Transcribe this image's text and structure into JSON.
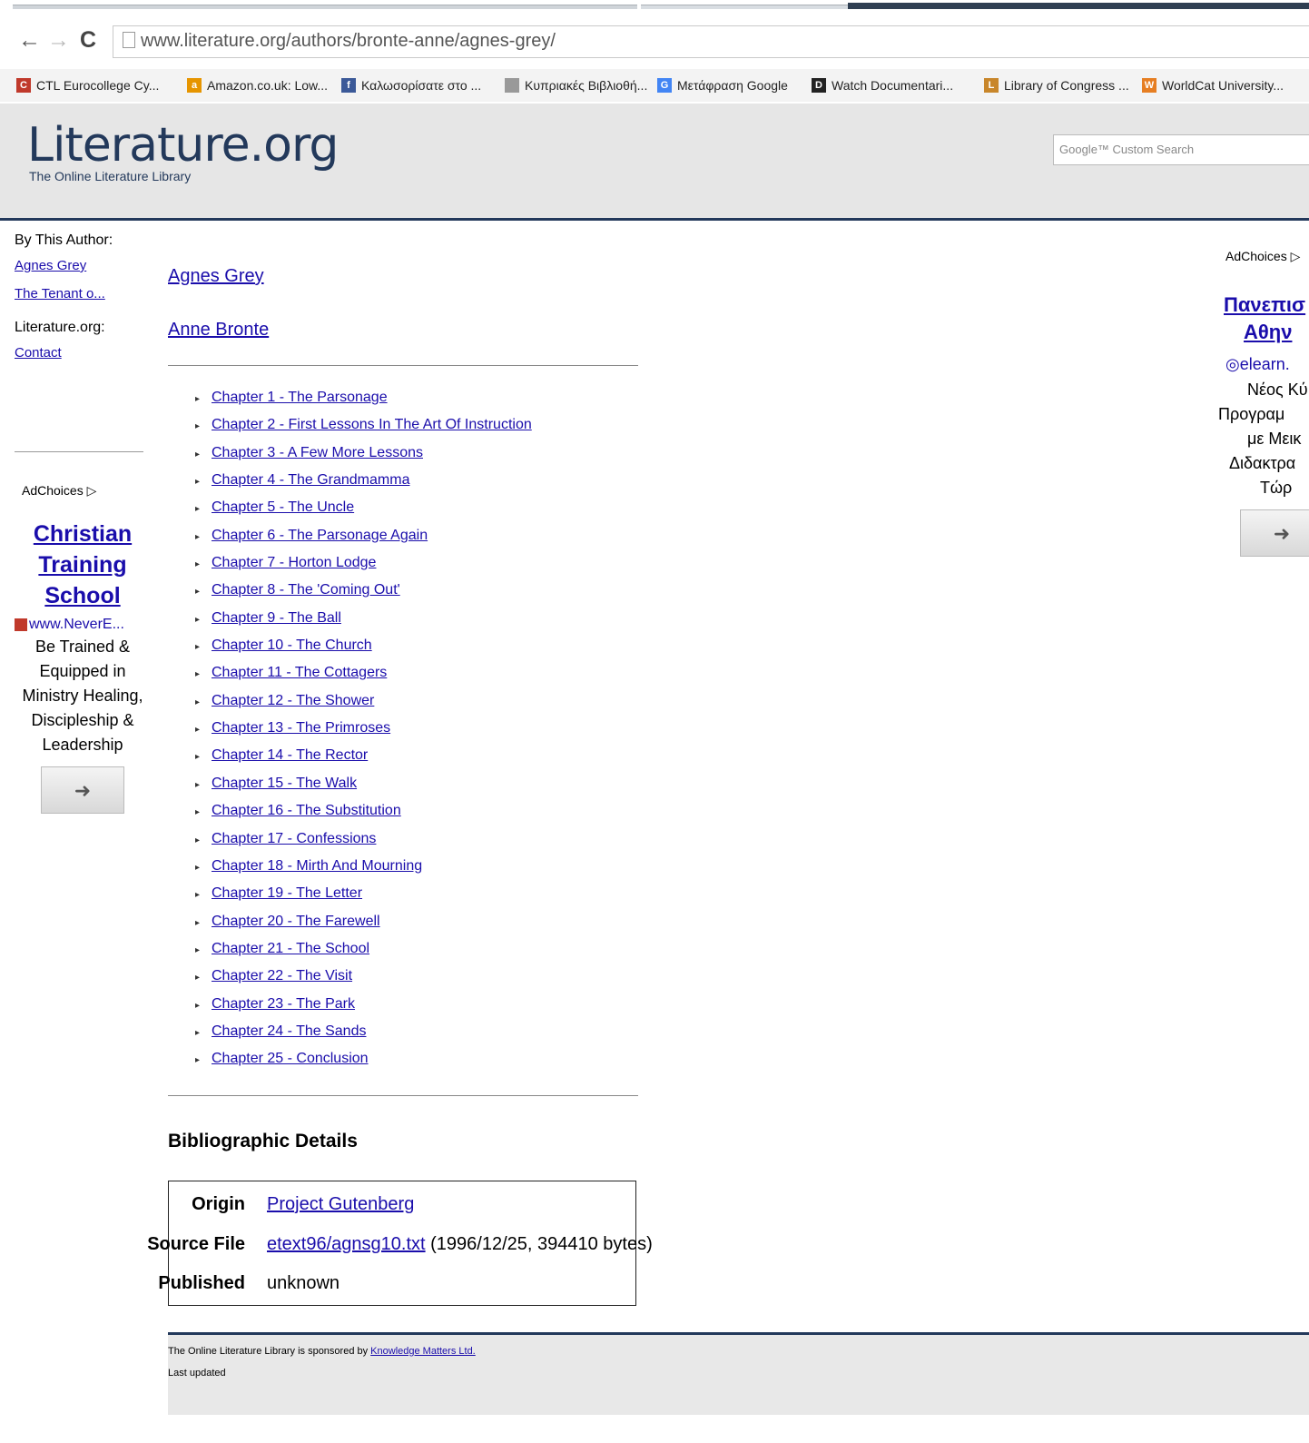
{
  "browser": {
    "url": "www.literature.org/authors/bronte-anne/agnes-grey/",
    "bookmarks": [
      {
        "label": "CTL Eurocollege Cy...",
        "icon": "ctl-favicon",
        "color": "#c0392b",
        "glyph": "C"
      },
      {
        "label": "Amazon.co.uk: Low...",
        "icon": "amazon-favicon",
        "color": "#e69500",
        "glyph": "a"
      },
      {
        "label": "Καλωσορίσατε στο ...",
        "icon": "facebook-favicon",
        "color": "#3b5998",
        "glyph": "f"
      },
      {
        "label": "Κυπριακές Βιβλιοθή...",
        "icon": "page-favicon",
        "color": "#999999",
        "glyph": ""
      },
      {
        "label": "Μετάφραση Google",
        "icon": "google-translate-favicon",
        "color": "#4285f4",
        "glyph": "G"
      },
      {
        "label": "Watch Documentari...",
        "icon": "documentary-favicon",
        "color": "#222222",
        "glyph": "D"
      },
      {
        "label": "Library of Congress ...",
        "icon": "loc-favicon",
        "color": "#c8862a",
        "glyph": "L"
      },
      {
        "label": "WorldCat University...",
        "icon": "worldcat-favicon",
        "color": "#e67e22",
        "glyph": "W"
      }
    ]
  },
  "header": {
    "title": "Literature.org",
    "subtitle": "The Online Literature Library",
    "search_placeholder": "Google™ Custom Search"
  },
  "left_nav": {
    "by_author_heading": "By This Author:",
    "by_author_links": [
      "Agnes Grey",
      "The Tenant o..."
    ],
    "site_heading": "Literature.org:",
    "site_links": [
      "Contact"
    ]
  },
  "left_ad": {
    "adchoices": "AdChoices ▷",
    "title": "Christian Training School",
    "url": "www.NeverE...",
    "body": "Be Trained & Equipped in Ministry Healing, Discipleship & Leadership",
    "arrow": "➜"
  },
  "main": {
    "book_title": "Agnes Grey",
    "author": "Anne Bronte",
    "chapters": [
      "Chapter 1 - The Parsonage",
      "Chapter 2 - First Lessons In The Art Of Instruction",
      "Chapter 3 - A Few More Lessons",
      "Chapter 4 - The Grandmamma",
      "Chapter 5 - The Uncle",
      "Chapter 6 - The Parsonage Again",
      "Chapter 7 - Horton Lodge",
      "Chapter 8 - The 'Coming Out'",
      "Chapter 9 - The Ball",
      "Chapter 10 - The Church",
      "Chapter 11 - The Cottagers",
      "Chapter 12 - The Shower",
      "Chapter 13 - The Primroses",
      "Chapter 14 - The Rector",
      "Chapter 15 - The Walk",
      "Chapter 16 - The Substitution",
      "Chapter 17 - Confessions",
      "Chapter 18 - Mirth And Mourning",
      "Chapter 19 - The Letter",
      "Chapter 20 - The Farewell",
      "Chapter 21 - The School",
      "Chapter 22 - The Visit",
      "Chapter 23 - The Park",
      "Chapter 24 - The Sands",
      "Chapter 25 - Conclusion"
    ],
    "bib_heading": "Bibliographic Details",
    "bib": {
      "origin_label": "Origin",
      "origin_value": "Project Gutenberg",
      "source_label": "Source File",
      "source_link": "etext96/agnsg10.txt",
      "source_meta": " (1996/12/25, 394410 bytes)",
      "published_label": "Published",
      "published_value": "unknown"
    }
  },
  "right_ad": {
    "adchoices": "AdChoices ▷",
    "title_line1": "Πανεπισ",
    "title_line2": "Αθην",
    "url": "elearn.",
    "body_lines": [
      "Νέος Κύ",
      "Προγραμ",
      "με Μεικ",
      "Διδακτρα",
      "Τώρ"
    ],
    "arrow": "➜"
  },
  "footer": {
    "sponsor_prefix": "The Online Literature Library is sponsored by ",
    "sponsor_link": "Knowledge Matters Ltd.",
    "updated": "Last updated"
  },
  "colors": {
    "brand": "#23395b",
    "link": "#1a0dab",
    "header_bg": "#e6e6e6"
  }
}
